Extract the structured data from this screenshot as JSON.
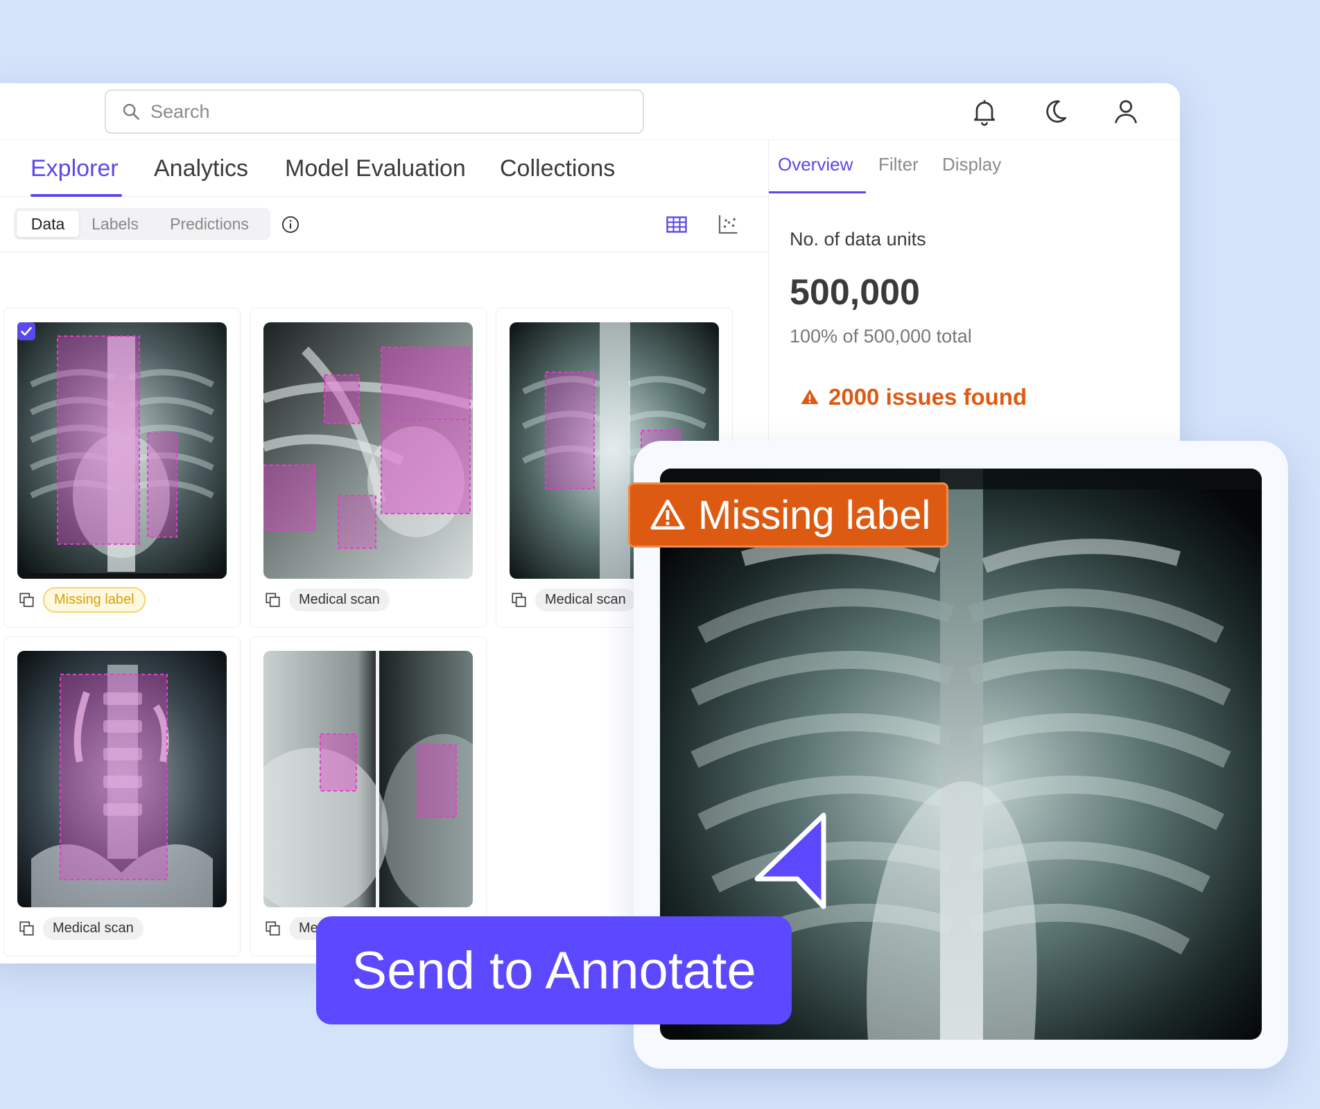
{
  "search": {
    "placeholder": "Search"
  },
  "header_icons": [
    "bell-icon",
    "moon-icon",
    "user-icon"
  ],
  "main_tabs": [
    {
      "label": "Explorer",
      "active": true
    },
    {
      "label": "Analytics"
    },
    {
      "label": "Model Evaluation"
    },
    {
      "label": "Collections"
    }
  ],
  "segment": [
    {
      "label": "Data",
      "active": true
    },
    {
      "label": "Labels"
    },
    {
      "label": "Predictions"
    }
  ],
  "cards": [
    {
      "tag": "Missing label",
      "selected": true
    },
    {
      "tag": "Medical scan"
    },
    {
      "tag": "Medical scan"
    },
    {
      "tag": "Medical scan"
    },
    {
      "tag": "Medical scan"
    }
  ],
  "right_tabs": [
    {
      "label": "Overview",
      "active": true
    },
    {
      "label": "Filter"
    },
    {
      "label": "Display"
    }
  ],
  "overview": {
    "label": "No. of data units",
    "value": "500,000",
    "sub": "100% of 500,000 total",
    "issues": "2000 issues found"
  },
  "preview": {
    "badge": "Missing label"
  },
  "cta": {
    "label": "Send to Annotate"
  },
  "colors": {
    "accent": "#5b48e8",
    "warning": "#dd5a12",
    "background": "#d4e3fa",
    "annotation": "#e040c8"
  }
}
